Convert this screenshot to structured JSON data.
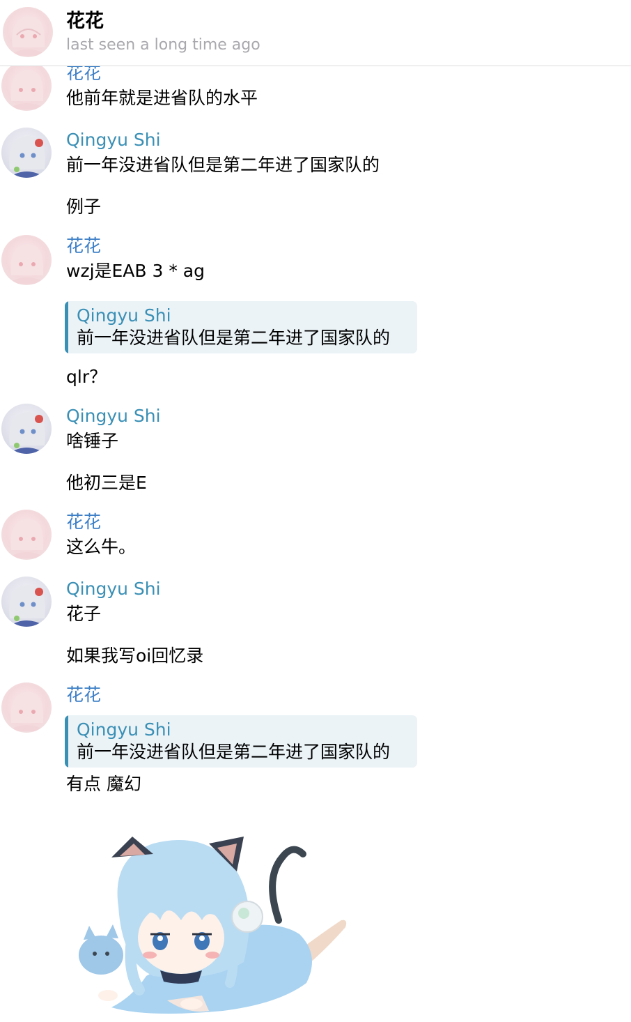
{
  "header": {
    "title": "花花",
    "status": "last seen a long time ago"
  },
  "messages": [
    {
      "sender": "花花",
      "lines": [
        "他前年就是进省队的水平"
      ]
    },
    {
      "sender": "Qingyu Shi",
      "lines": [
        "前一年没进省队但是第二年进了国家队的",
        "例子"
      ]
    },
    {
      "sender": "花花",
      "lines": [
        "wzj是EAB 3 * ag",
        "qlr？"
      ],
      "reply": {
        "name": "Qingyu Shi",
        "text": "前一年没进省队但是第二年进了国家队的"
      }
    },
    {
      "sender": "Qingyu Shi",
      "lines": [
        "啥锤子",
        "他初三是E"
      ]
    },
    {
      "sender": "花花",
      "lines": [
        "这么牛。"
      ]
    },
    {
      "sender": "Qingyu Shi",
      "lines": [
        "花子",
        "如果我写oi回忆录"
      ]
    },
    {
      "sender": "花花",
      "lines": [
        "有点  魔幻"
      ],
      "reply": {
        "name": "Qingyu Shi",
        "text": "前一年没进省队但是第二年进了国家队的"
      },
      "sticker": "blue-haired-cat-girl-sticker"
    }
  ],
  "colors": {
    "hua_name": "#3d7fc6",
    "qingyu_name": "#3a8fb5",
    "reply_bg": "#ebf3f7",
    "status_gray": "#a8a8ad"
  }
}
